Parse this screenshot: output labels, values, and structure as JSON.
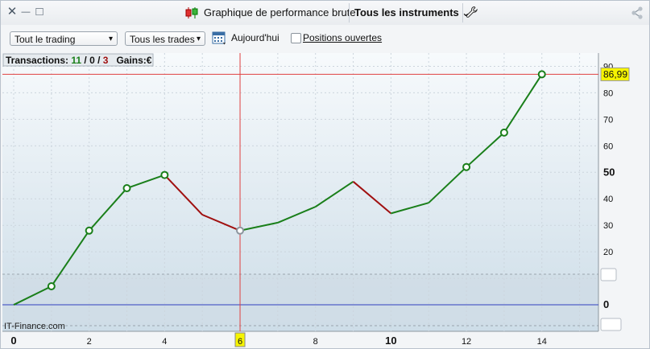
{
  "titlebar": {
    "close_glyph": "✕",
    "minimize_glyph": "—",
    "maximize_glyph": "□",
    "title": "Graphique de performance brute",
    "instruments_label": "Tous les instruments",
    "instruments_caret": "⌄"
  },
  "toolbar": {
    "scope_select": "Tout le trading",
    "trades_select": "Tous les trades",
    "today_label": "Aujourd'hui",
    "open_positions_label": "Positions ouvertes",
    "open_positions_checked": false
  },
  "stats": {
    "transactions_label": "Transactions:",
    "wins": "11",
    "sep1": "/",
    "neutral": "0",
    "sep2": "/",
    "losses": "3",
    "gains_label": "Gains:",
    "currency": "€"
  },
  "watermark": "IT-Finance.com",
  "colors": {
    "up": "#1a7f1a",
    "down": "#a01010",
    "crosshair": "#e04040",
    "zero_line": "#2f3fbf",
    "highlight": "#f6f400"
  },
  "chart_data": {
    "type": "line",
    "x": [
      0,
      1,
      2,
      3,
      4,
      5,
      6,
      7,
      8,
      9,
      10,
      11,
      12,
      13,
      14
    ],
    "y": [
      0,
      7,
      28,
      44,
      49,
      34,
      28,
      31,
      37,
      46.5,
      34.5,
      38.5,
      52,
      65,
      86.99
    ],
    "markers": [
      1,
      2,
      3,
      4,
      6,
      12,
      13,
      14
    ],
    "segment_colors": [
      "up",
      "up",
      "up",
      "up",
      "down",
      "down",
      "up",
      "up",
      "up",
      "down",
      "up",
      "up",
      "up",
      "up"
    ],
    "xlim": [
      0,
      15.5
    ],
    "ylim": [
      -10,
      95
    ],
    "x_ticks": [
      {
        "v": 0,
        "label": "0",
        "bold": true
      },
      {
        "v": 2,
        "label": "2"
      },
      {
        "v": 4,
        "label": "4"
      },
      {
        "v": 6,
        "label": "6",
        "highlight": true
      },
      {
        "v": 8,
        "label": "8"
      },
      {
        "v": 10,
        "label": "10",
        "bold": true
      },
      {
        "v": 12,
        "label": "12"
      },
      {
        "v": 14,
        "label": "14"
      }
    ],
    "y_ticks": [
      {
        "v": 0,
        "label": "0",
        "bold": true
      },
      {
        "v": 20,
        "label": "20"
      },
      {
        "v": 30,
        "label": "30"
      },
      {
        "v": 40,
        "label": "40"
      },
      {
        "v": 50,
        "label": "50",
        "bold": true
      },
      {
        "v": 60,
        "label": "60"
      },
      {
        "v": 70,
        "label": "70"
      },
      {
        "v": 80,
        "label": "80"
      },
      {
        "v": 90,
        "label": "90"
      }
    ],
    "crosshair": {
      "x": 6,
      "y": 86.99,
      "y_label": "86,99"
    },
    "grid": true
  }
}
